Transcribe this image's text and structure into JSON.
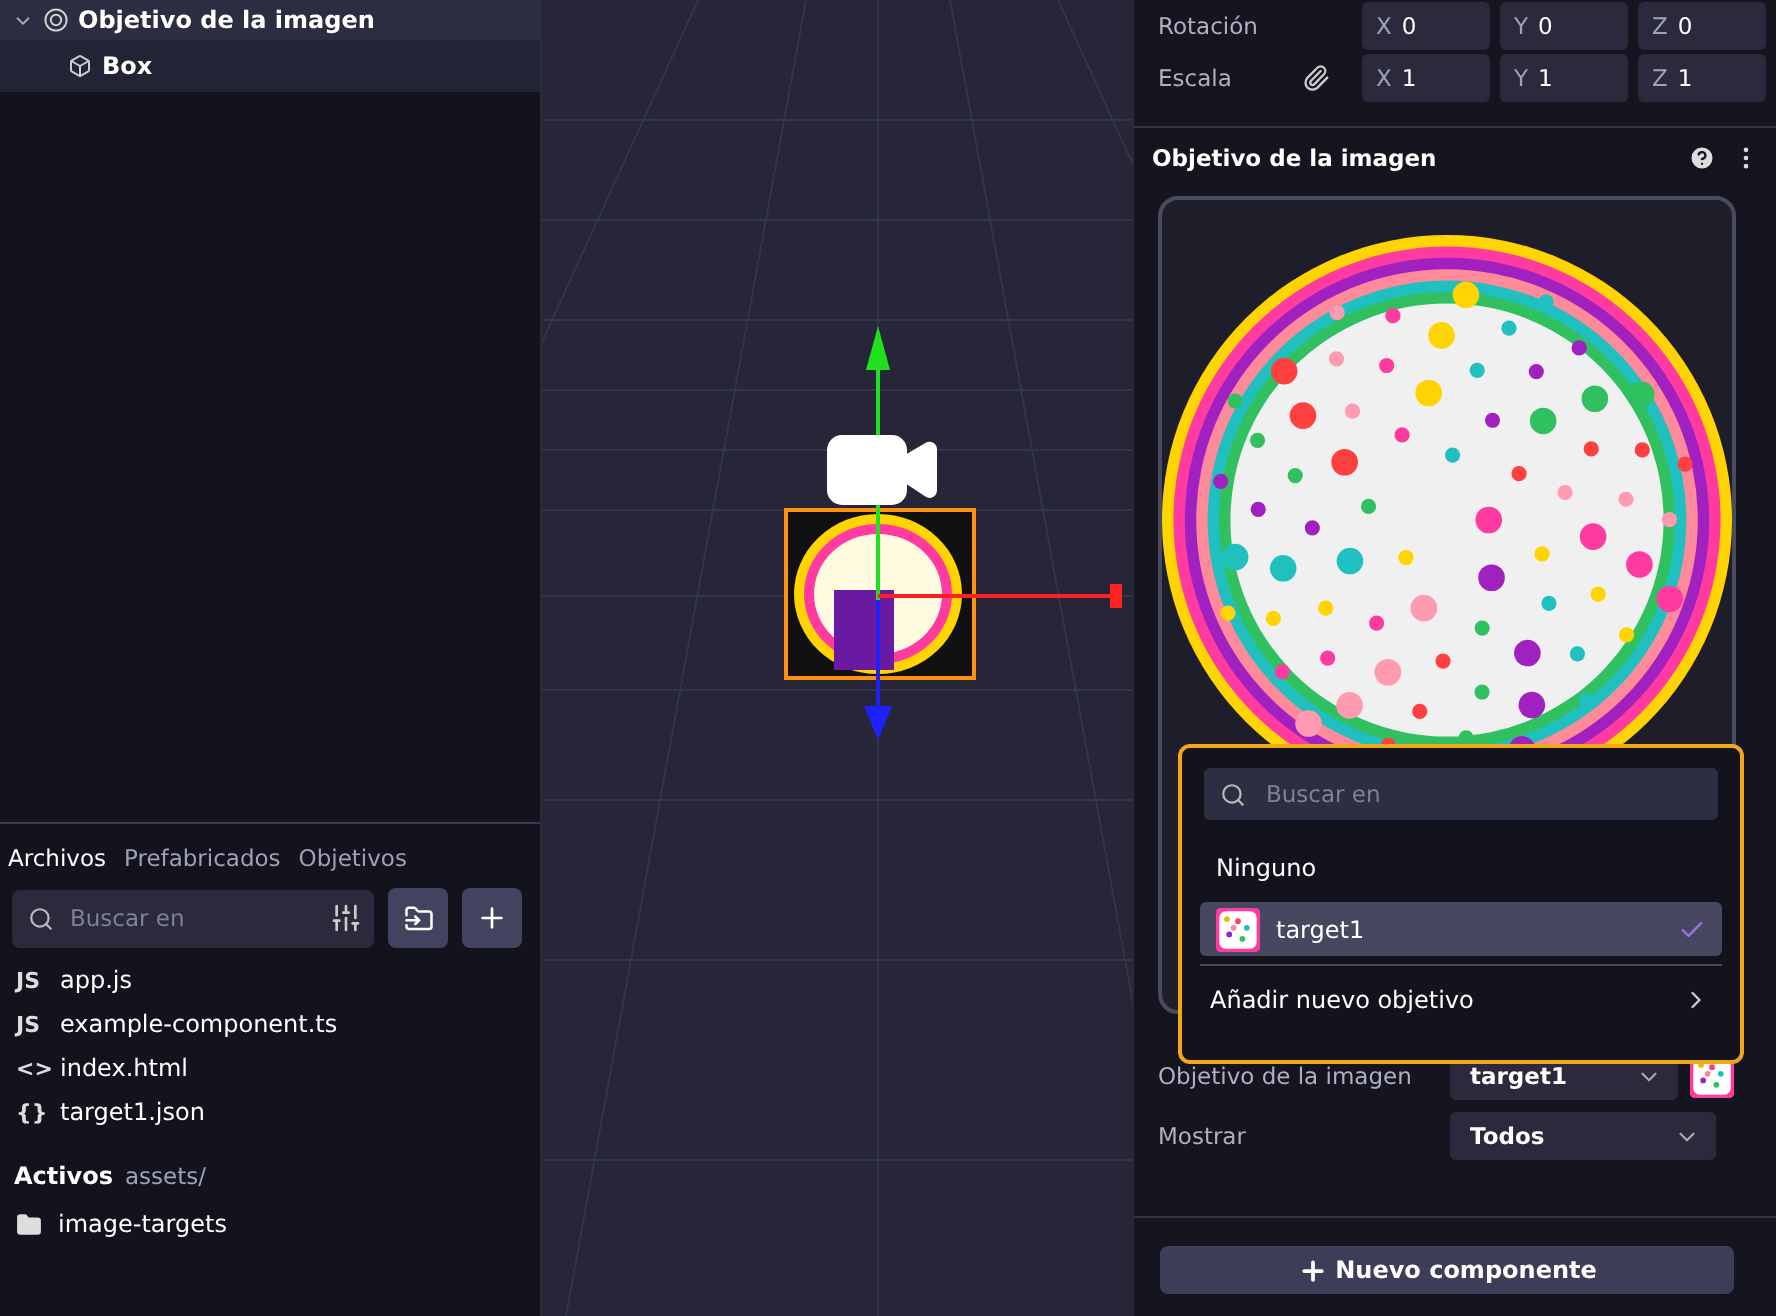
{
  "hierarchy": [
    {
      "label": "Objetivo de la imagen",
      "kind": "target",
      "expanded": true,
      "selected": true
    },
    {
      "label": "Box",
      "kind": "box",
      "selected": false
    }
  ],
  "files_panel": {
    "tabs": [
      {
        "label": "Archivos",
        "selected": true
      },
      {
        "label": "Prefabricados",
        "selected": false
      },
      {
        "label": "Objetivos",
        "selected": false
      }
    ],
    "search": {
      "placeholder": "Buscar en"
    },
    "files": [
      {
        "badge": "JS",
        "name": "app.js"
      },
      {
        "badge": "JS",
        "name": "example-component.ts"
      },
      {
        "badge": "<>",
        "name": "index.html"
      },
      {
        "badge": "{}",
        "name": "target1.json"
      }
    ],
    "assets": {
      "title": "Activos",
      "path": "assets/",
      "folders": [
        "image-targets"
      ]
    }
  },
  "inspector": {
    "transform": [
      {
        "label": "Rotación",
        "linked": false,
        "fields": [
          {
            "axis": "X",
            "value": "0"
          },
          {
            "axis": "Y",
            "value": "0"
          },
          {
            "axis": "Z",
            "value": "0"
          }
        ]
      },
      {
        "label": "Escala",
        "linked": true,
        "fields": [
          {
            "axis": "X",
            "value": "1"
          },
          {
            "axis": "Y",
            "value": "1"
          },
          {
            "axis": "Z",
            "value": "1"
          }
        ]
      }
    ],
    "section_title": "Objetivo de la imagen",
    "dropdown": {
      "search_placeholder": "Buscar en",
      "options": [
        {
          "label": "Ninguno",
          "thumbnail": false,
          "selected": false
        },
        {
          "label": "target1",
          "thumbnail": true,
          "selected": true
        }
      ],
      "add_label": "Añadir nuevo objetivo"
    },
    "properties": [
      {
        "label": "Objetivo de la imagen",
        "value": "target1",
        "thumbnail": true
      },
      {
        "label": "Mostrar",
        "value": "Todos",
        "thumbnail": false
      }
    ],
    "add_button": "Nuevo componente"
  }
}
